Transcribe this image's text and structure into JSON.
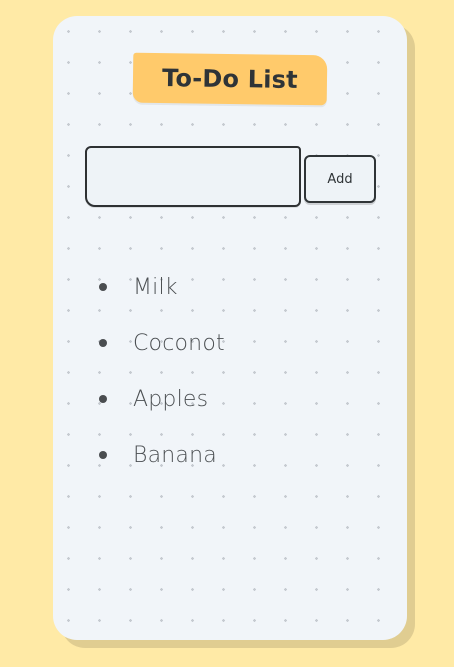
{
  "app": {
    "title": "To-Do List"
  },
  "input": {
    "value": "",
    "placeholder": ""
  },
  "actions": {
    "add_label": "Add"
  },
  "todos": [
    {
      "label": "Milk"
    },
    {
      "label": "Coconot"
    },
    {
      "label": "Apples"
    },
    {
      "label": "Banana"
    }
  ],
  "colors": {
    "page_background": "#ffeaa6",
    "card_background": "#f1f5f9",
    "title_banner": "#ffca6b",
    "text": "#2f3437"
  }
}
